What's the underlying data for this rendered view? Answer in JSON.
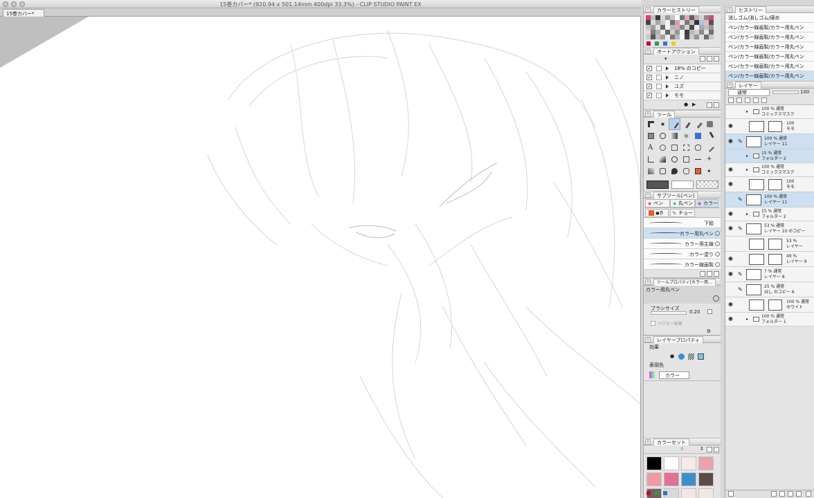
{
  "window": {
    "title": "15巻カバー* (920.94 x 501.14mm 400dpi 33.3%) - CLIP STUDIO PAINT EX",
    "doc_tab": "15巻カバー*"
  },
  "color_history": {
    "title": "カラーヒストリー",
    "colors": [
      "#e63a7a",
      "#bdbdbd",
      "#3a3a3a",
      "#d8d8d8",
      "#9b9b9b",
      "#c7c7c7",
      "#ffffff",
      "#777777",
      "#e2a9b6",
      "#5e5e5e",
      "#c9a6b8",
      "#d4d4d4",
      "#8c8c8c",
      "#cf4b82",
      "#444444",
      "#dadada",
      "#a9a9a9",
      "#cccccc",
      "#f0f0f0",
      "#6f6f6f",
      "#d99cab",
      "#e7e7e7",
      "#7a7a7a",
      "#bfbfbf",
      "#333333",
      "#a6c9e0",
      "#e8b9c4",
      "#555555",
      "#c4c4c4",
      "#9f9f9f",
      "#e1e1e1",
      "#6a6a6a",
      "#f5f5f5",
      "#b6b6b6",
      "#cdb1bd",
      "#888888",
      "#d3d3d3",
      "#4a4a4a",
      "#eeeeee",
      "#aaaaaa",
      "#c1c1c1",
      "#999999",
      "#dddddd",
      "#7f7f7f",
      "#b1b1b1",
      "#e9e9e9",
      "#666666",
      "#cfcfcf",
      "#959595",
      "#f2f2f2",
      "#404040",
      "#bababa",
      "#d0d0d0",
      "#8a8a8a",
      "#e4e4e4",
      "#727272",
      "#d7c1c9",
      "#5a5a5a",
      "#c0c0c0",
      "#a1a1a1",
      "#ebebeb",
      "#7d7d7d",
      "#b9b9b9",
      "#f7f7f7",
      "#474747",
      "#cacaca",
      "#939393",
      "#e0e0e0",
      "#6d6d6d",
      "#c9c9c9"
    ],
    "bottom_chips": [
      "#b0123a",
      "#2d9c4b",
      "#3a6fd0",
      "#e2d21a"
    ]
  },
  "auto_action": {
    "title": "オートアクション",
    "items": [
      {
        "label": "18% のコピー",
        "checked": true
      },
      {
        "label": "ニノ",
        "checked": true
      },
      {
        "label": "ユズ",
        "checked": true
      },
      {
        "label": "モモ",
        "checked": true
      }
    ]
  },
  "tool_panel": {
    "title": "ツール"
  },
  "sub_tool": {
    "title": "サブツール[ペン]",
    "tabs": [
      "ペン",
      "丸ペン",
      "カラー",
      "チョー"
    ],
    "items": [
      {
        "label": "下絵"
      },
      {
        "label": "カラー用丸ペン",
        "selected": true
      },
      {
        "label": "カラー用主線"
      },
      {
        "label": "カラー塗り"
      },
      {
        "label": "カラー線画製"
      }
    ]
  },
  "tool_property": {
    "title": "ツールプロパティ[カラー用…",
    "tool_name": "カラー用丸ペン",
    "brush_size_label": "ブラシサイズ",
    "brush_size_value": "0.20",
    "vector_label": "ベクター吸着"
  },
  "layer_property": {
    "title": "レイヤープロパティ",
    "effect_label": "効果",
    "expression_label": "表現色",
    "expression_value": "カラー"
  },
  "color_set": {
    "title": "カラーセット",
    "set_name": "☆",
    "colors": [
      "#000000",
      "#ffffff",
      "#f5e9ea",
      "#e9a2ae",
      "#f09aa6",
      "#e07094",
      "#3f8fc6",
      "#5e4a48",
      "#7a5f5f",
      "#d9d9d9",
      "#f3e6e4",
      "#f1e8e2"
    ],
    "bottom_chips": [
      "#b0123a",
      "#2d9c4b",
      "#3a6fd0"
    ]
  },
  "history": {
    "title": "ヒストリー",
    "items": [
      {
        "label": "消しゴム/消しゴム/硬め"
      },
      {
        "label": "ペン/カラー線画製/カラー用丸ペン"
      },
      {
        "label": "ペン/カラー線画製/カラー用丸ペン"
      },
      {
        "label": "ペン/カラー線画製/カラー用丸ペン"
      },
      {
        "label": "ペン/カラー線画製/カラー用丸ペン"
      },
      {
        "label": "ペン/カラー線画製/カラー用丸ペン"
      },
      {
        "label": "ペン/カラー線画製/カラー用丸ペン",
        "selected": true
      }
    ]
  },
  "layers": {
    "title": "レイヤー",
    "blend_mode": "通常",
    "opacity": "100",
    "items": [
      {
        "line1": "100 % 通常",
        "line2": "コミックスマスク",
        "kind": "folder"
      },
      {
        "line1": "100",
        "line2": "モモ",
        "kind": "mask"
      },
      {
        "line1": "100 % 通常",
        "line2": "レイヤー 11",
        "kind": "layer",
        "selected": true
      },
      {
        "line1": "15 % 通常",
        "line2": "フォルダー 2",
        "kind": "folder",
        "selected": true
      },
      {
        "line1": "100 % 通常",
        "line2": "コミックスマスク",
        "kind": "folder"
      },
      {
        "line1": "100",
        "line2": "モモ",
        "kind": "mask"
      },
      {
        "line1": "100 % 通常",
        "line2": "レイヤー 11",
        "kind": "layer",
        "selected": true
      },
      {
        "line1": "15 % 通常",
        "line2": "フォルダー 2",
        "kind": "folder"
      },
      {
        "line1": "53 % 通常",
        "line2": "レイヤー 10 のコピー",
        "kind": "layer"
      },
      {
        "line1": "53 %",
        "line2": "レイヤー",
        "kind": "mask"
      },
      {
        "line1": "49 %",
        "line2": "レイヤー 9",
        "kind": "mask"
      },
      {
        "line1": "7 % 通常",
        "line2": "レイヤー 8",
        "kind": "layer"
      },
      {
        "line1": "25 % 通常",
        "line2": "ほし のコピー 6",
        "kind": "layer"
      },
      {
        "line1": "100 % 通常",
        "line2": "ホワイト",
        "kind": "mask"
      },
      {
        "line1": "100 % 通常",
        "line2": "フォルダー 1",
        "kind": "folder"
      }
    ]
  }
}
